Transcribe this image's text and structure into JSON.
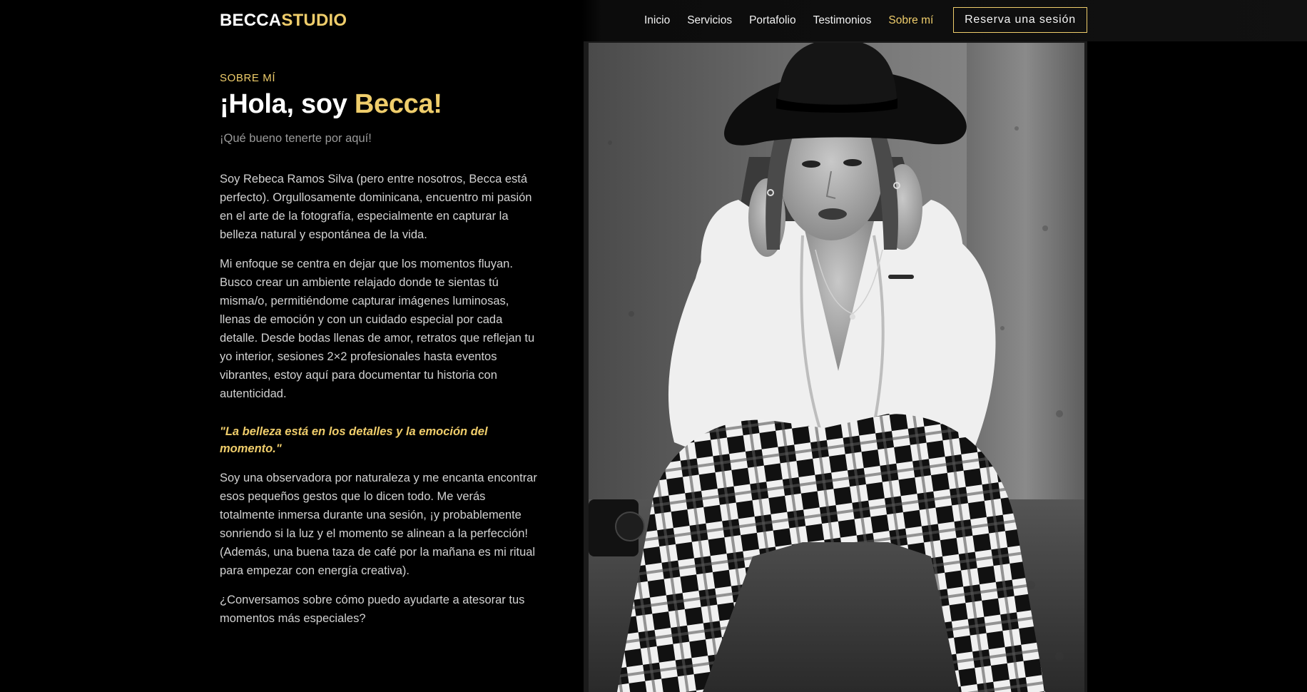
{
  "brand": {
    "logo_main": "BECCA",
    "logo_accent": "STUDIO"
  },
  "nav": {
    "links": [
      {
        "label": "Inicio"
      },
      {
        "label": "Servicios"
      },
      {
        "label": "Portafolio"
      },
      {
        "label": "Testimonios"
      },
      {
        "label": "Sobre mí"
      }
    ],
    "cta_label": "Reserva una sesión"
  },
  "about": {
    "eyebrow": "SOBRE MÍ",
    "headline_prefix": "¡Hola, soy ",
    "headline_accent": "Becca!",
    "subtitle": "¡Qué bueno tenerte por aquí!",
    "paragraph_1": "Soy Rebeca Ramos Silva (pero entre nosotros, Becca está perfecto). Orgullosamente dominicana, encuentro mi pasión en el arte de la fotografía, especialmente en capturar la belleza natural y espontánea de la vida.",
    "paragraph_2": "Mi enfoque se centra en dejar que los momentos fluyan. Busco crear un ambiente relajado donde te sientas tú misma/o, permitiéndome capturar imágenes luminosas, llenas de emoción y con un cuidado especial por cada detalle. Desde bodas llenas de amor, retratos que reflejan tu yo interior, sesiones 2×2 profesionales hasta eventos vibrantes, estoy aquí para documentar tu historia con autenticidad.",
    "quote": "\"La belleza está en los detalles y la emoción del momento.\"",
    "paragraph_3": "Soy una observadora por naturaleza y me encanta encontrar esos pequeños gestos que lo dicen todo. Me verás totalmente inmersa durante una sesión, ¡y probablemente sonriendo si la luz y el momento se alinean a la perfección! (Además, una buena taza de café por la mañana es mi ritual para empezar con energía creativa).",
    "paragraph_4": "¿Conversamos sobre cómo puedo ayudarte a atesorar tus momentos más especiales?"
  },
  "colors": {
    "accent": "#efcd6b",
    "background": "#000000",
    "text": "#d2d2d2"
  }
}
